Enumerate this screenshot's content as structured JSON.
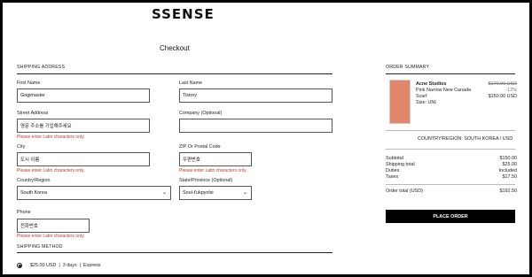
{
  "header": {
    "logo": "SSENSE",
    "title": "Checkout"
  },
  "shipping_address": {
    "section_title": "SHIPPING ADDRESS",
    "first_name": {
      "label": "First Name",
      "value": "Gogimaster"
    },
    "last_name": {
      "label": "Last Name",
      "value": "Tistory"
    },
    "street_address": {
      "label": "Street Address",
      "value": "영문 주소를 기입해주세요",
      "error": "Please enter Latin characters only."
    },
    "company": {
      "label": "Company (Optional)",
      "value": ""
    },
    "city": {
      "label": "City",
      "value": "도시 이름",
      "error": "Please enter Latin characters only."
    },
    "zip": {
      "label": "ZIP Or Postal Code",
      "value": "우편번호",
      "error": "Please enter Latin characters only."
    },
    "country": {
      "label": "Country/Region",
      "value": "South Korea"
    },
    "state": {
      "label": "State/Province (Optional)",
      "value": "Soul-t'ukpyolsi"
    },
    "phone": {
      "label": "Phone",
      "value": "전화번호",
      "error": "Please enter Latin characters only."
    }
  },
  "shipping_method": {
    "section_title": "SHIPPING METHOD",
    "option": "$25.00 USD  |  3 days  |  Express"
  },
  "order_summary": {
    "section_title": "ORDER SUMMARY",
    "item": {
      "brand": "Acne Studios",
      "name_line1": "Pink Narrow New Canada",
      "name_line2": "Scarf",
      "size": "Size: UNI",
      "original_price": "$170.00 USD",
      "discount": "-12%",
      "price": "$150.00 USD",
      "swatch_color": "#e0876b"
    },
    "country_line": "COUNTRY/REGION: SOUTH KOREA / USD",
    "subtotal": {
      "label": "Subtotal",
      "value": "$150.00"
    },
    "shipping_total": {
      "label": "Shipping total",
      "value": "$25.00"
    },
    "duties": {
      "label": "Duties",
      "value": "Included"
    },
    "taxes": {
      "label": "Taxes",
      "value": "$17.50"
    },
    "order_total": {
      "label": "Order total (USD)",
      "value": "$192.50"
    },
    "place_order": "PLACE ORDER"
  }
}
